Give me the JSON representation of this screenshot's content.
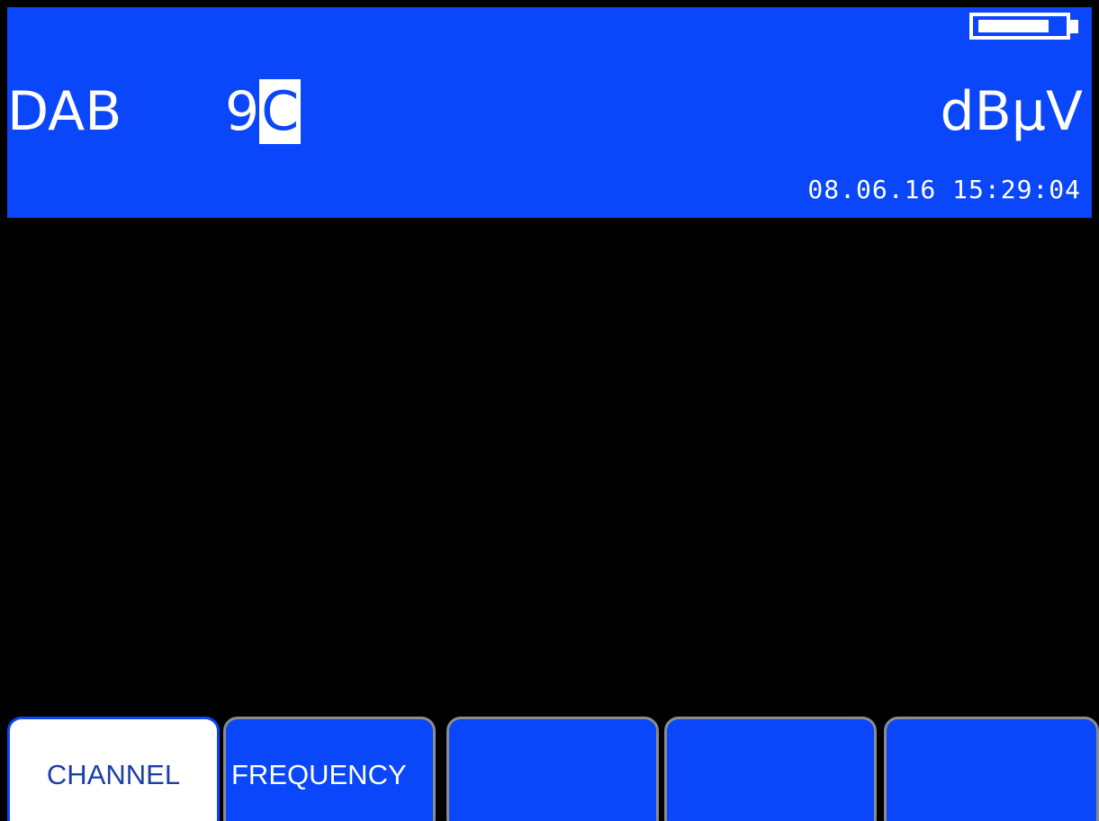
{
  "header": {
    "mode": "DAB",
    "channel_prefix": "9",
    "channel_cursor": "C",
    "unit": "dBµV",
    "datetime": "08.06.16 15:29:04",
    "battery_level": 0.85,
    "background_color": "#0a46fa"
  },
  "softkeys": [
    {
      "label": "CHANNEL",
      "active": true
    },
    {
      "label": "FREQUENCY",
      "active": false
    },
    {
      "label": "",
      "active": false
    },
    {
      "label": "",
      "active": false
    },
    {
      "label": "",
      "active": false
    }
  ]
}
